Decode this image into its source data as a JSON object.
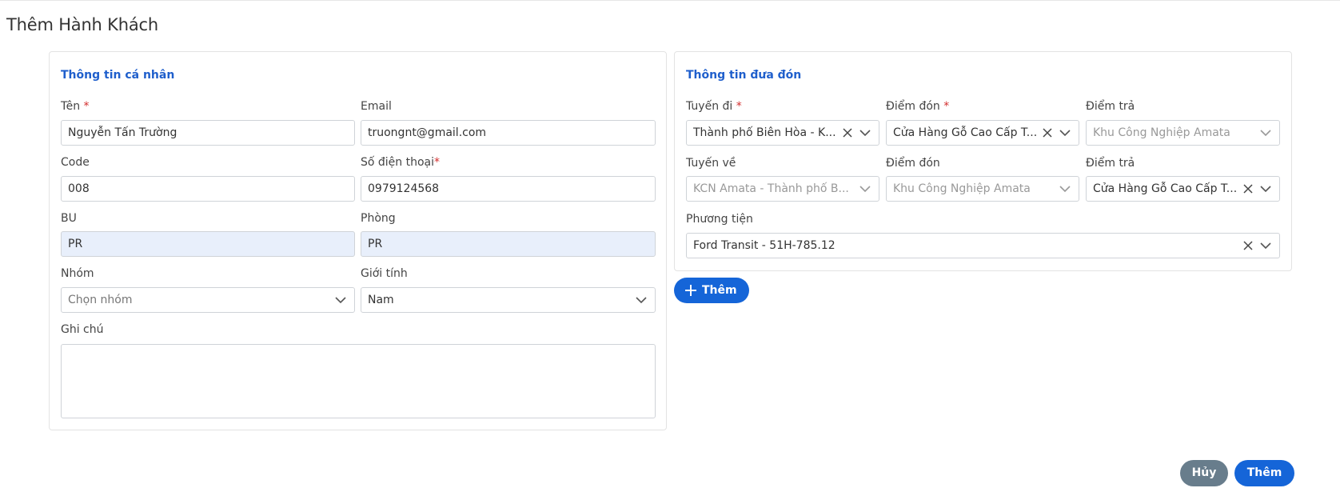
{
  "page": {
    "title": "Thêm Hành Khách"
  },
  "personal": {
    "title": "Thông tin cá nhân",
    "name": {
      "label": "Tên",
      "required": "*",
      "value": "Nguyễn Tấn Trường"
    },
    "email": {
      "label": "Email",
      "value": "truongnt@gmail.com"
    },
    "code": {
      "label": "Code",
      "value": "008"
    },
    "phone": {
      "label": "Số điện thoại",
      "required": "*",
      "value": "0979124568"
    },
    "bu": {
      "label": "BU",
      "value": "PR"
    },
    "room": {
      "label": "Phòng",
      "value": "PR"
    },
    "group": {
      "label": "Nhóm",
      "placeholder": "Chọn nhóm"
    },
    "gender": {
      "label": "Giới tính",
      "value": "Nam"
    },
    "note": {
      "label": "Ghi chú",
      "value": ""
    }
  },
  "transport": {
    "title": "Thông tin đưa đón",
    "route_out": {
      "label": "Tuyến đi",
      "required": "*",
      "value": "Thành phố Biên Hòa - K..."
    },
    "pickup_out": {
      "label": "Điểm đón",
      "required": "*",
      "value": "Cửa Hàng Gỗ Cao Cấp T..."
    },
    "drop_out": {
      "label": "Điểm trả",
      "value": "Khu Công Nghiệp Amata"
    },
    "route_back": {
      "label": "Tuyến về",
      "value": "KCN Amata - Thành phố B..."
    },
    "pickup_back": {
      "label": "Điểm đón",
      "value": "Khu Công Nghiệp Amata"
    },
    "drop_back": {
      "label": "Điểm trả",
      "value": "Cửa Hàng Gỗ Cao Cấp T..."
    },
    "vehicle": {
      "label": "Phương tiện",
      "value": "Ford Transit - 51H-785.12"
    },
    "add_label": "Thêm"
  },
  "actions": {
    "cancel_label": "Hủy",
    "submit_label": "Thêm"
  },
  "colors": {
    "accent": "#1565d8",
    "title_blue": "#1f5fcc",
    "cancel": "#687d8c",
    "required": "#d32f2f",
    "filled_bg": "#e8effb"
  },
  "icons": {
    "chevron": "chevron-down-icon",
    "clear": "close-icon",
    "plus": "plus-icon"
  }
}
